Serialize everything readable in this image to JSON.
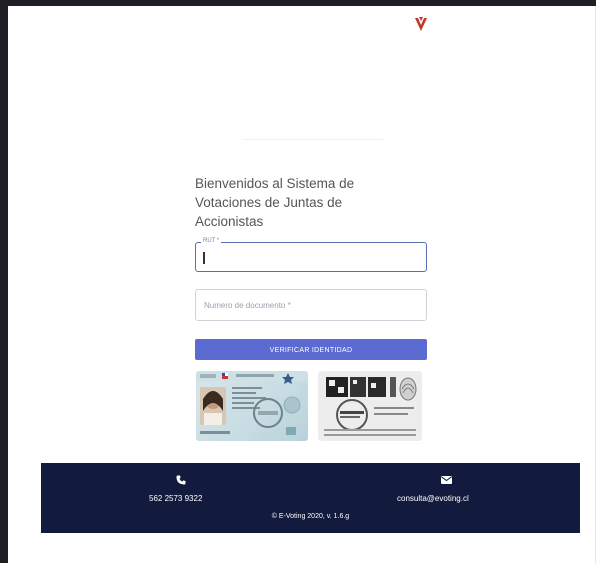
{
  "welcome": {
    "line1": "Bienvenidos al Sistema de",
    "line2": "Votaciones de Juntas de",
    "line3": "Accionistas"
  },
  "form": {
    "rut_label": "RUT *",
    "rut_value": "",
    "doc_placeholder": "Numero de documento *",
    "verify_label": "VERIFICAR IDENTIDAD"
  },
  "footer": {
    "phone": "562 2573 9322",
    "email": "consulta@evoting.cl",
    "copyright": "© E-Voting 2020, v. 1.6.g"
  },
  "colors": {
    "primary_button": "#5b6bd1",
    "footer_bg": "#121b3e",
    "logo": "#c0392b"
  },
  "icons": {
    "logo": "evoting-logo-icon",
    "phone": "phone-icon",
    "email": "mail-icon"
  }
}
